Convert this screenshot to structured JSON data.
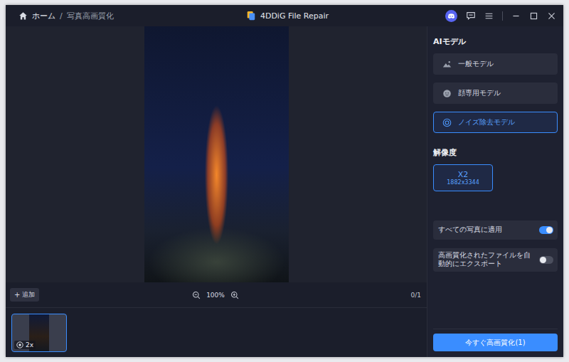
{
  "window": {
    "title": "4DDiG File Repair"
  },
  "breadcrumb": {
    "items": [
      "ホーム",
      "写真高画質化"
    ],
    "separator": "/"
  },
  "sidebar": {
    "title": "AIモデル",
    "models": [
      {
        "label": "一般モデル",
        "selected": false
      },
      {
        "label": "顔専用モデル",
        "selected": false
      },
      {
        "label": "ノイズ除去モデル",
        "selected": true
      }
    ],
    "resolution_title": "解像度",
    "resolutions": [
      {
        "label": "X2",
        "size": "1882x3344",
        "selected": true
      }
    ],
    "toggles": [
      {
        "label": "すべての写真に適用",
        "on": true
      },
      {
        "label": "高画質化されたファイルを自動的にエクスポート",
        "on": false
      }
    ],
    "action": "今すぐ高画質化(1)"
  },
  "toolbar": {
    "add_icon": "+",
    "add": "追加",
    "zoom": "100%",
    "page": "0/1"
  },
  "thumbnails": [
    {
      "badge": "2x",
      "selected": true
    }
  ]
}
